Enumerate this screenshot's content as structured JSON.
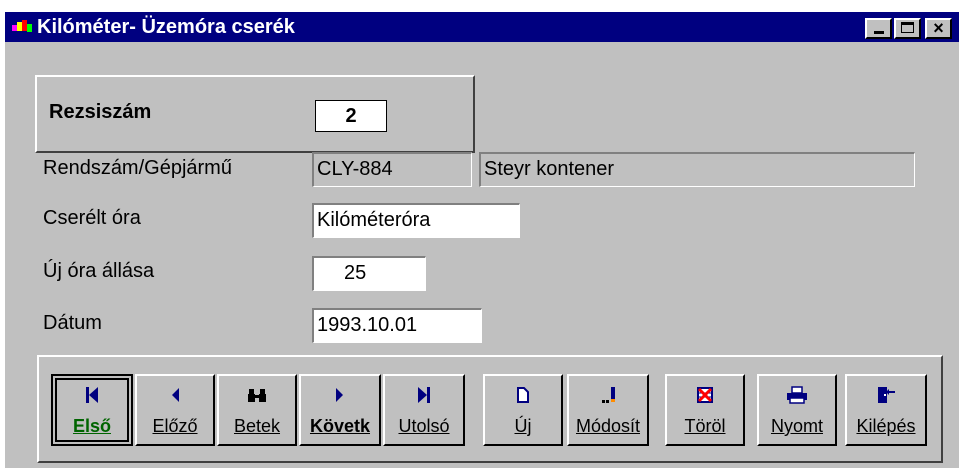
{
  "window": {
    "title": "Kilóméter- Üzemóra cserék",
    "close_glyph": "×",
    "accent_color": "#000080"
  },
  "rezsi": {
    "label": "Rezsiszám",
    "value": "2"
  },
  "fields": {
    "rendszam_label": "Rendszám/Gépjármű",
    "rendszam_value": "CLY-884",
    "jarmu_value": "Steyr kontener",
    "cserelt_label": "Cserélt óra",
    "cserelt_value": "Kilóméteróra",
    "uj_ora_label": "Új óra állása",
    "uj_ora_value": "25",
    "datum_label": "Dátum",
    "datum_value": "1993.10.01"
  },
  "nav": {
    "elso": "Első",
    "elozo": "Előző",
    "betek": "Betek",
    "kovetk": "Követk",
    "utolso": "Utolsó",
    "uj": "Új",
    "modosit": "Módosít",
    "torol": "Töröl",
    "nyomt": "Nyomt",
    "kilepes": "Kilépés"
  }
}
